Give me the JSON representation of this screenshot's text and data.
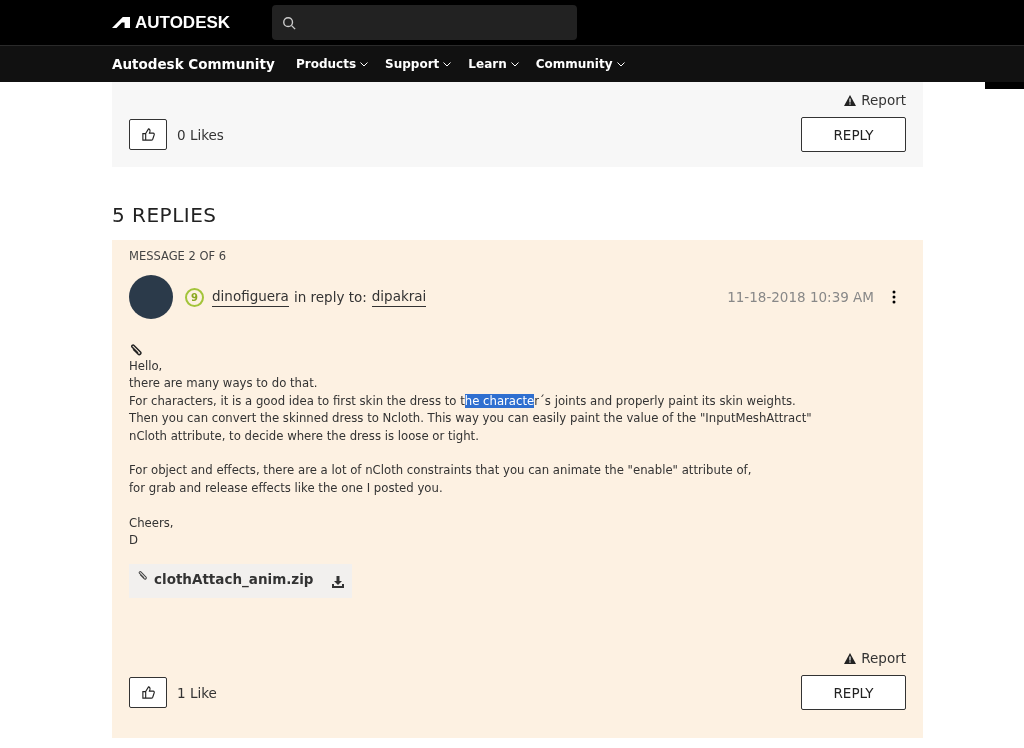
{
  "header": {
    "brand": "AUTODESK"
  },
  "nav": {
    "site_title": "Autodesk Community",
    "menus": [
      {
        "label": "Products"
      },
      {
        "label": "Support"
      },
      {
        "label": "Learn"
      },
      {
        "label": "Community"
      }
    ]
  },
  "previous_post": {
    "report": "Report",
    "likes": "0 Likes",
    "reply": "REPLY"
  },
  "replies_heading": "5 REPLIES",
  "message": {
    "counter": "MESSAGE 2 OF 6",
    "rank": "9",
    "author": "dinofiguera",
    "in_reply_to": "in reply to:",
    "reply_to_user": "dipakrai",
    "date": "11-18-2018 10:39 AM",
    "body_lines": [
      {
        "kind": "text",
        "segments": [
          {
            "text": "Hello,",
            "selected": false
          }
        ]
      },
      {
        "kind": "text",
        "segments": [
          {
            "text": "there are many ways to do that.",
            "selected": false
          }
        ]
      },
      {
        "kind": "text",
        "segments": [
          {
            "text": "For characters, it is a good idea to first skin the dress to t",
            "selected": false
          },
          {
            "text": "he characte",
            "selected": true
          },
          {
            "text": "r´s joints and properly paint its skin weights.",
            "selected": false
          }
        ]
      },
      {
        "kind": "text",
        "segments": [
          {
            "text": "Then you can convert the skinned dress to Ncloth. This way you can easily paint the value of the \"InputMeshAttract\"",
            "selected": false
          }
        ]
      },
      {
        "kind": "text",
        "segments": [
          {
            "text": "nCloth attribute, to decide where the dress is loose or tight.",
            "selected": false
          }
        ]
      },
      {
        "kind": "blank"
      },
      {
        "kind": "text",
        "segments": [
          {
            "text": "For object and effects, there are a lot of nCloth constraints that you can animate the \"enable\" attribute of,",
            "selected": false
          }
        ]
      },
      {
        "kind": "text",
        "segments": [
          {
            "text": "for grab and release effects like the one I posted you.",
            "selected": false
          }
        ]
      },
      {
        "kind": "blank"
      },
      {
        "kind": "text",
        "segments": [
          {
            "text": "Cheers,",
            "selected": false
          }
        ]
      },
      {
        "kind": "text",
        "segments": [
          {
            "text": "D",
            "selected": false
          }
        ]
      }
    ],
    "attachment": "clothAttach_anim.zip",
    "report": "Report",
    "likes": "1 Like",
    "reply": "REPLY"
  }
}
